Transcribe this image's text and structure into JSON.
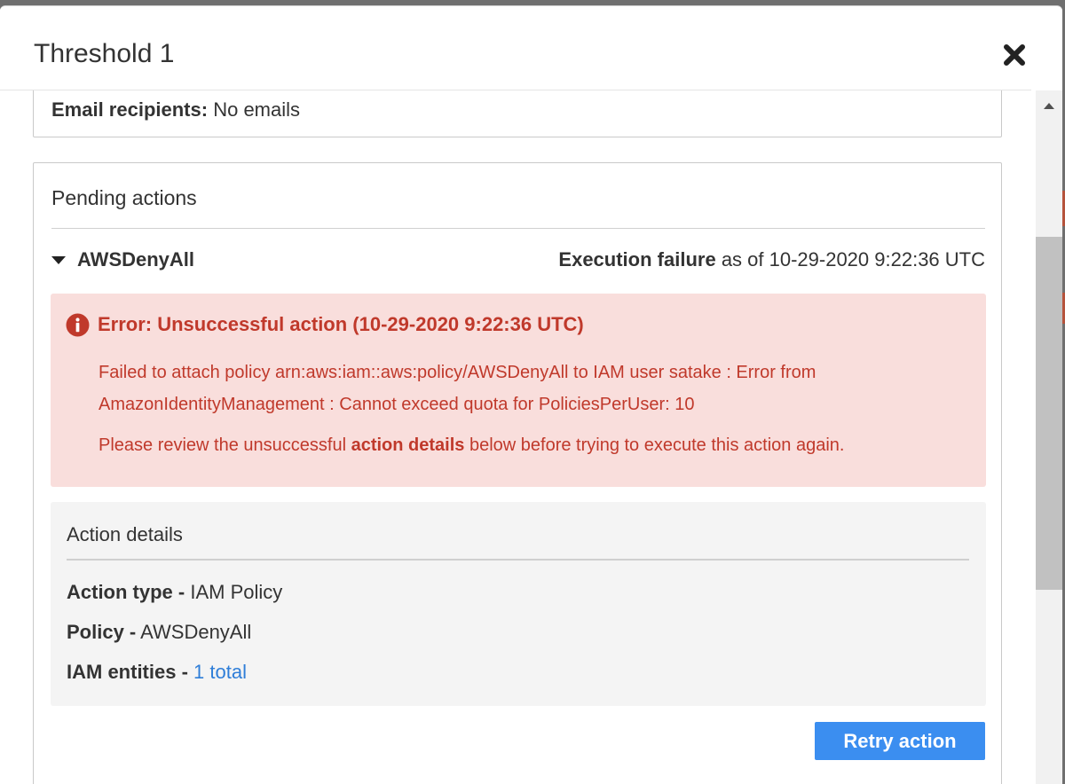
{
  "modal": {
    "title": "Threshold 1"
  },
  "email": {
    "label": "Email recipients:",
    "value": "No emails"
  },
  "pending": {
    "title": "Pending actions",
    "action": {
      "name": "AWSDenyAll",
      "status_label": "Execution failure",
      "status_suffix": "as of 10-29-2020 9:22:36 UTC"
    },
    "alert": {
      "title": "Error: Unsuccessful action (10-29-2020 9:22:36 UTC)",
      "message_line1": "Failed to attach policy arn:aws:iam::aws:policy/AWSDenyAll to IAM user satake : Error from",
      "message_line2": "AmazonIdentityManagement : Cannot exceed quota for PoliciesPerUser: 10",
      "note_prefix": "Please review the unsuccessful ",
      "note_bold": "action details",
      "note_suffix": " below before trying to execute this action again."
    },
    "details": {
      "title": "Action details",
      "action_type_label": "Action type -",
      "action_type_value": "IAM Policy",
      "policy_label": "Policy -",
      "policy_value": "AWSDenyAll",
      "entities_label": "IAM entities -",
      "entities_link": "1 total"
    },
    "retry_label": "Retry action"
  },
  "colors": {
    "error": "#c0392b",
    "error_bg": "#f9dedc",
    "primary": "#3b8ef0",
    "link": "#2f7ed8"
  },
  "icons": {
    "close": "close-icon",
    "info": "info-icon",
    "caret": "caret-down-icon",
    "scroll_up": "scroll-up-arrow-icon"
  }
}
